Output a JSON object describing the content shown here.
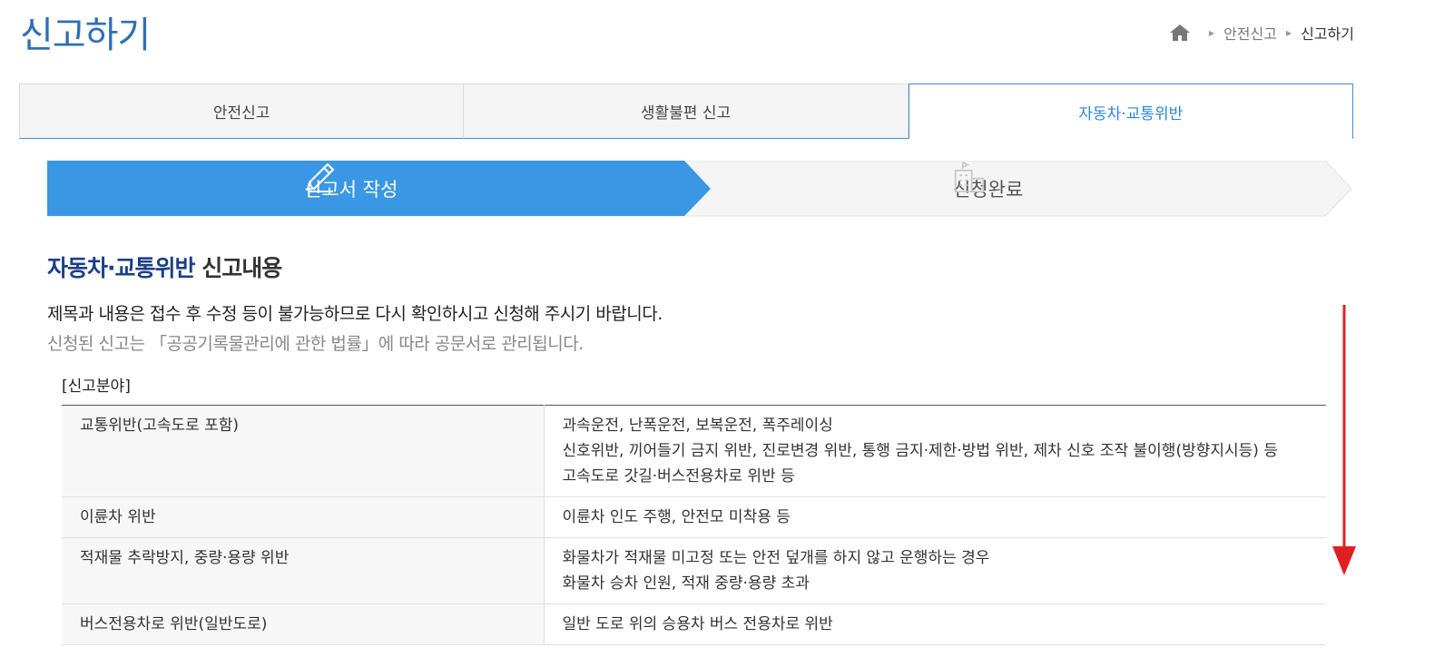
{
  "page": {
    "title": "신고하기"
  },
  "breadcrumb": {
    "items": [
      "안전신고",
      "신고하기"
    ]
  },
  "tabs": [
    {
      "label": "안전신고",
      "active": false
    },
    {
      "label": "생활불편 신고",
      "active": false
    },
    {
      "label": "자동차·교통위반",
      "active": true
    }
  ],
  "steps": [
    {
      "label": "신고서 작성",
      "icon": "pencil-icon",
      "active": true
    },
    {
      "label": "신청완료",
      "icon": "building-flag-icon",
      "active": false
    }
  ],
  "section": {
    "title_accent": "자동차·교통위반",
    "title_rest": " 신고내용"
  },
  "notice": {
    "line1": "제목과 내용은 접수 후 수정 등이 불가능하므로 다시 확인하시고 신청해 주시기 바랍니다.",
    "line2": "신청된 신고는 「공공기록물관리에 관한 법률」에 따라 공문서로 관리됩니다."
  },
  "field_label": "[신고분야]",
  "categories": [
    {
      "name": "교통위반(고속도로 포함)",
      "details": [
        "과속운전, 난폭운전, 보복운전, 폭주레이싱",
        "신호위반, 끼어들기 금지 위반, 진로변경 위반, 통행 금지·제한·방법 위반, 제차 신호 조작 불이행(방향지시등) 등",
        "고속도로 갓길·버스전용차로 위반 등"
      ]
    },
    {
      "name": "이륜차 위반",
      "details": [
        "이륜차 인도 주행, 안전모 미착용 등"
      ]
    },
    {
      "name": "적재물 추락방지, 중량·용량 위반",
      "details": [
        "화물차가 적재물 미고정 또는 안전 덮개를 하지 않고 운행하는 경우",
        "화물차 승차 인원, 적재 중량·용량 초과"
      ]
    },
    {
      "name": "버스전용차로 위반(일반도로)",
      "details": [
        "일반 도로 위의 승용차 버스 전용차로 위반"
      ]
    }
  ],
  "colors": {
    "primary": "#3a97e4",
    "title": "#2f6fb5",
    "accent": "#1d3f87",
    "arrow": "#e02020"
  }
}
